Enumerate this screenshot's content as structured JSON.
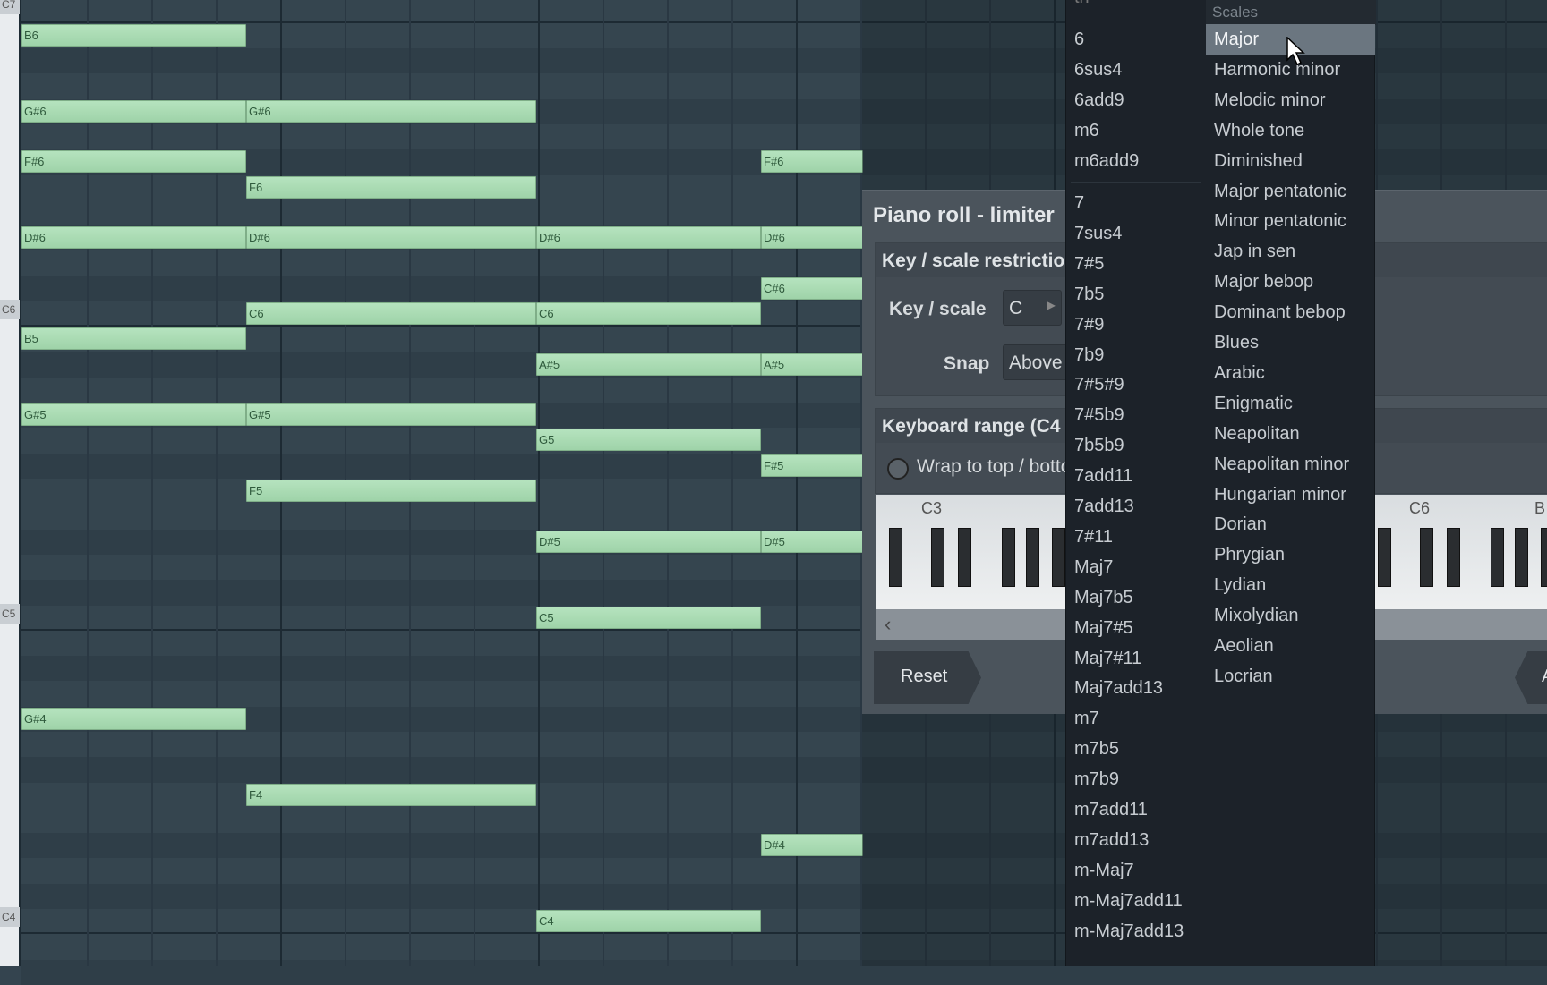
{
  "piano_roll": {
    "key_labels": [
      "C7",
      "C6",
      "C5",
      "C4"
    ],
    "notes": [
      {
        "label": "B6",
        "slot": 1
      },
      {
        "label": "G#6",
        "slot": 1
      },
      {
        "label": "F#6",
        "slot": 1
      },
      {
        "label": "D#6",
        "slot": 1
      },
      {
        "label": "B5",
        "slot": 1
      },
      {
        "label": "G#5",
        "slot": 1
      },
      {
        "label": "G#4",
        "slot": 1
      },
      {
        "label": "G#6",
        "slot": 2
      },
      {
        "label": "F6",
        "slot": 2
      },
      {
        "label": "D#6",
        "slot": 2
      },
      {
        "label": "C6",
        "slot": 2
      },
      {
        "label": "G#5",
        "slot": 2
      },
      {
        "label": "F5",
        "slot": 2
      },
      {
        "label": "F4",
        "slot": 2
      },
      {
        "label": "D#6",
        "slot": 3
      },
      {
        "label": "C6",
        "slot": 3
      },
      {
        "label": "A#5",
        "slot": 3
      },
      {
        "label": "G5",
        "slot": 3
      },
      {
        "label": "D#5",
        "slot": 3
      },
      {
        "label": "C5",
        "slot": 3
      },
      {
        "label": "C4",
        "slot": 3
      },
      {
        "label": "F#6",
        "slot": 4
      },
      {
        "label": "D#6",
        "slot": 4
      },
      {
        "label": "C#6",
        "slot": 4
      },
      {
        "label": "A#5",
        "slot": 4
      },
      {
        "label": "F#5",
        "slot": 4
      },
      {
        "label": "D#5",
        "slot": 4
      },
      {
        "label": "D#4",
        "slot": 4
      }
    ],
    "note_color": "#a8dab2"
  },
  "dialog": {
    "title": "Piano roll - limiter",
    "section1": "Key / scale restriction",
    "key_scale_label": "Key / scale",
    "key_value": "C",
    "snap_label": "Snap",
    "snap_value": "Above",
    "section2": "Keyboard range (C4",
    "wrap_label": "Wrap to top / bottom",
    "octave_labels": [
      "C3",
      "C6",
      "B"
    ],
    "scroll_left": "‹",
    "reset": "Reset",
    "right_button": "A"
  },
  "menu": {
    "chords_top_partial": "th",
    "chords_group1": [
      "6",
      "6sus4",
      "6add9",
      "m6",
      "m6add9"
    ],
    "chords_group2": [
      "7",
      "7sus4",
      "7#5",
      "7b5",
      "7#9",
      "7b9",
      "7#5#9",
      "7#5b9",
      "7b5b9",
      "7add11",
      "7add13",
      "7#11",
      "Maj7",
      "Maj7b5",
      "Maj7#5",
      "Maj7#11",
      "Maj7add13",
      "m7",
      "m7b5",
      "m7b9",
      "m7add11",
      "m7add13",
      "m-Maj7",
      "m-Maj7add11",
      "m-Maj7add13"
    ],
    "scales_header": "Scales",
    "scales": [
      "Major",
      "Harmonic minor",
      "Melodic minor",
      "Whole tone",
      "Diminished",
      "Major pentatonic",
      "Minor pentatonic",
      "Jap in sen",
      "Major bebop",
      "Dominant bebop",
      "Blues",
      "Arabic",
      "Enigmatic",
      "Neapolitan",
      "Neapolitan minor",
      "Hungarian minor",
      "Dorian",
      "Phrygian",
      "Lydian",
      "Mixolydian",
      "Aeolian",
      "Locrian"
    ],
    "selected_scale": "Major"
  }
}
